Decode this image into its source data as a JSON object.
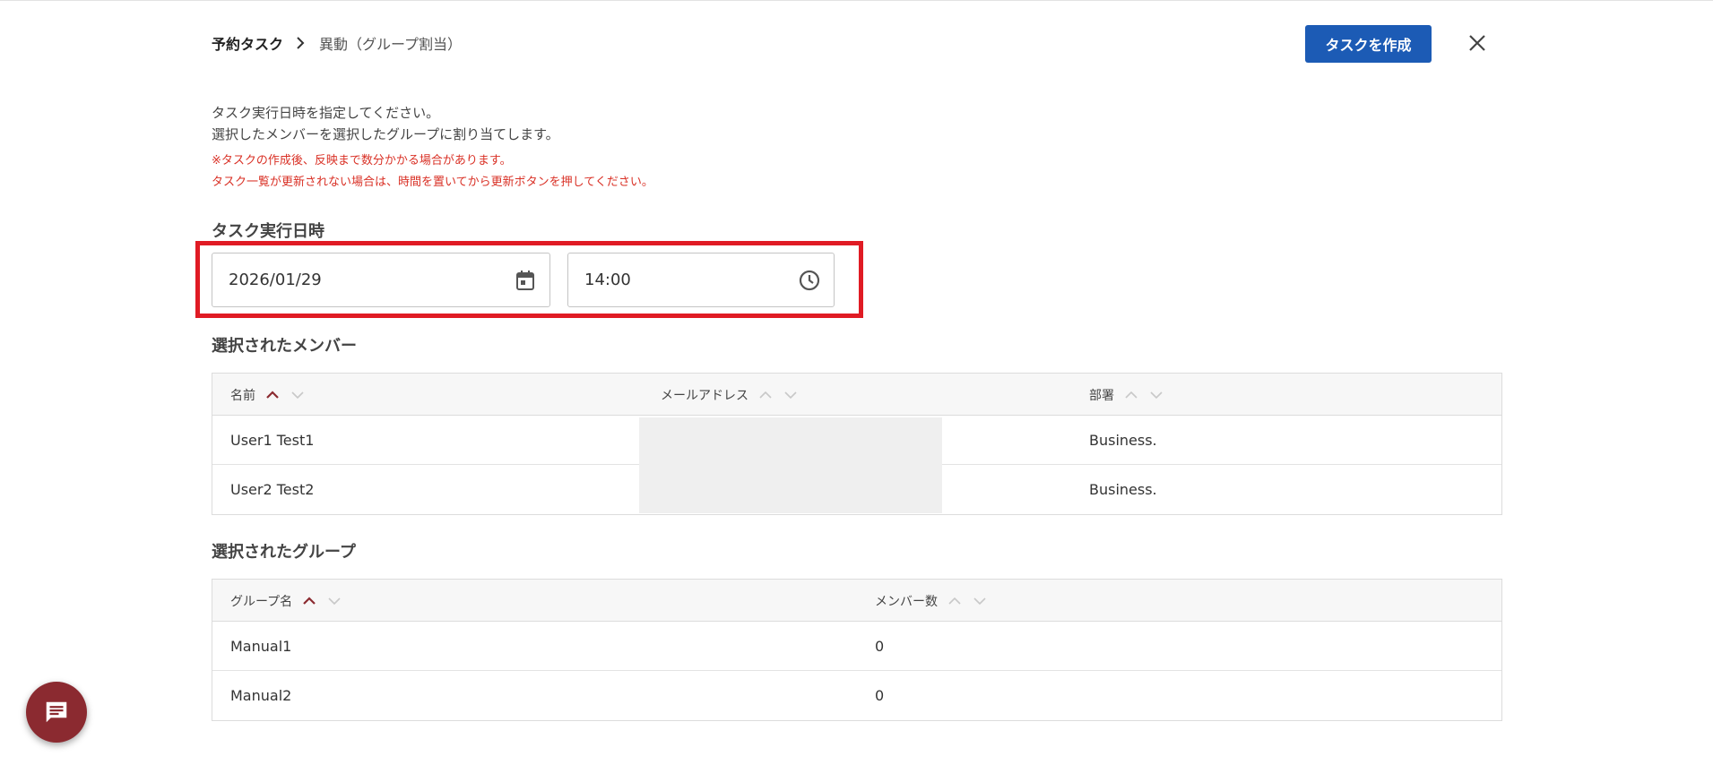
{
  "breadcrumb": {
    "root": "予約タスク",
    "current": "異動（グループ割当）"
  },
  "header": {
    "create_button": "タスクを作成"
  },
  "description": {
    "line1": "タスク実行日時を指定してください。",
    "line2": "選択したメンバーを選択したグループに割り当てします。",
    "note1": "※タスクの作成後、反映まで数分かかる場合があります。",
    "note2": "タスク一覧が更新されない場合は、時間を置いてから更新ボタンを押してください。"
  },
  "schedule": {
    "title": "タスク実行日時",
    "date": "2026/01/29",
    "time": "14:00"
  },
  "members": {
    "title": "選択されたメンバー",
    "columns": [
      "名前",
      "メールアドレス",
      "部署"
    ],
    "rows": [
      {
        "name": "User1 Test1",
        "email": "",
        "department": "Business."
      },
      {
        "name": "User2 Test2",
        "email": "",
        "department": "Business."
      }
    ]
  },
  "groups": {
    "title": "選択されたグループ",
    "columns": [
      "グループ名",
      "メンバー数"
    ],
    "rows": [
      {
        "name": "Manual1",
        "count": "0"
      },
      {
        "name": "Manual2",
        "count": "0"
      }
    ]
  },
  "colors": {
    "primary": "#1c5bb5",
    "highlight": "#e01b24",
    "warning": "#d93025",
    "fab": "#8b2a30"
  },
  "icons": {
    "breadcrumb_sep": "chevron-right-icon",
    "close": "close-icon",
    "date": "calendar-icon",
    "time": "clock-icon",
    "chat": "chat-icon",
    "sort_asc": "sort-asc-icon",
    "sort_desc": "sort-desc-icon"
  }
}
